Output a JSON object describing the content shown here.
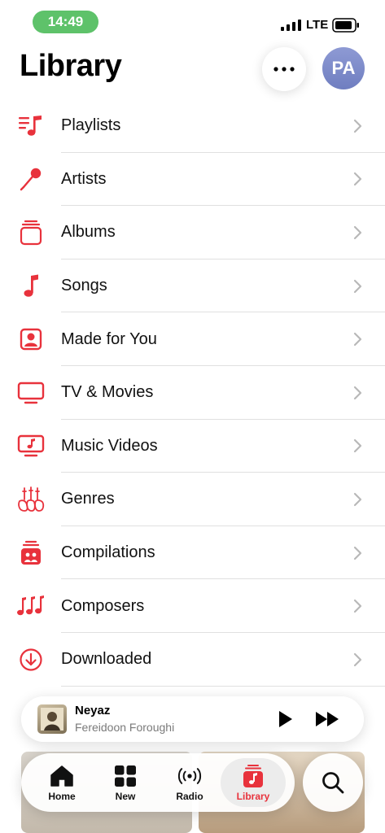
{
  "status_bar": {
    "time": "14:49",
    "network": "LTE"
  },
  "header": {
    "title": "Library",
    "avatar_initials": "PA"
  },
  "colors": {
    "accent": "#e8323c",
    "time_pill": "#5ec26a"
  },
  "library_items": [
    {
      "label": "Playlists",
      "icon": "playlists-icon"
    },
    {
      "label": "Artists",
      "icon": "microphone-icon"
    },
    {
      "label": "Albums",
      "icon": "album-stack-icon"
    },
    {
      "label": "Songs",
      "icon": "music-note-icon"
    },
    {
      "label": "Made for You",
      "icon": "person-square-icon"
    },
    {
      "label": "TV & Movies",
      "icon": "tv-icon"
    },
    {
      "label": "Music Videos",
      "icon": "music-video-icon"
    },
    {
      "label": "Genres",
      "icon": "guitars-icon"
    },
    {
      "label": "Compilations",
      "icon": "compilation-icon"
    },
    {
      "label": "Composers",
      "icon": "composers-notes-icon"
    },
    {
      "label": "Downloaded",
      "icon": "download-circle-icon"
    }
  ],
  "now_playing": {
    "title": "Neyaz",
    "artist": "Fereidoon Foroughi"
  },
  "tabs": [
    {
      "label": "Home",
      "icon": "home-icon",
      "active": false
    },
    {
      "label": "New",
      "icon": "grid-icon",
      "active": false
    },
    {
      "label": "Radio",
      "icon": "radio-waves-icon",
      "active": false
    },
    {
      "label": "Library",
      "icon": "library-icon",
      "active": true
    }
  ],
  "search_tab": {
    "icon": "search-icon"
  }
}
